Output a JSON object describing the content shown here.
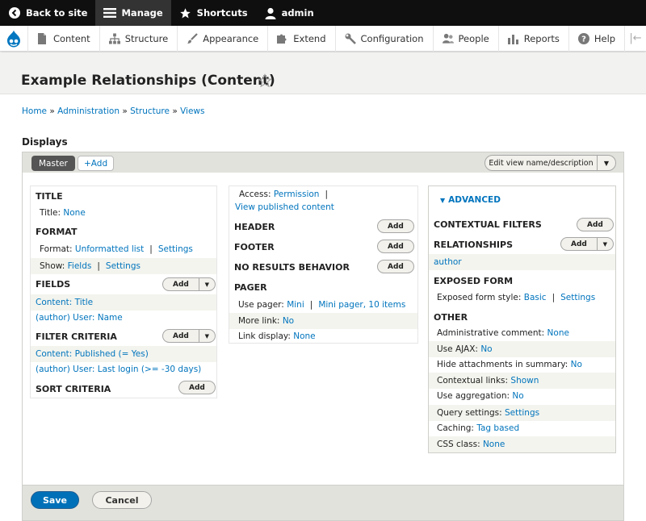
{
  "toolbar": {
    "back": "Back to site",
    "manage": "Manage",
    "shortcuts": "Shortcuts",
    "user": "admin"
  },
  "tray": {
    "items": [
      "Content",
      "Structure",
      "Appearance",
      "Extend",
      "Configuration",
      "People",
      "Reports",
      "Help"
    ]
  },
  "page": {
    "title": "Example Relationships (Content)",
    "breadcrumb": [
      "Home",
      "Administration",
      "Structure",
      "Views"
    ],
    "breadcrumb_sep": "»",
    "displays_label": "Displays"
  },
  "displays": {
    "master": "Master",
    "add": "+Add",
    "edit_view": "Edit view name/description"
  },
  "col1": {
    "title_section": "TITLE",
    "title_key": "Title:",
    "title_val": "None",
    "format_section": "FORMAT",
    "format_key": "Format:",
    "format_val": "Unformatted list",
    "format_settings": "Settings",
    "show_key": "Show:",
    "show_val": "Fields",
    "show_settings": "Settings",
    "fields_section": "FIELDS",
    "field1": "Content: Title",
    "field2": "(author) User: Name",
    "filter_section": "FILTER CRITERIA",
    "filter1": "Content: Published (= Yes)",
    "filter2": "(author) User: Last login (>= -30 days)",
    "sort_section": "SORT CRITERIA",
    "add": "Add"
  },
  "col2": {
    "access_key": "Access:",
    "access_val": "Permission",
    "access_val2": "View published content",
    "header_section": "HEADER",
    "footer_section": "FOOTER",
    "noresults_section": "NO RESULTS BEHAVIOR",
    "pager_section": "PAGER",
    "use_pager_key": "Use pager:",
    "use_pager_val": "Mini",
    "use_pager_val2": "Mini pager, 10 items",
    "more_link_key": "More link:",
    "more_link_val": "No",
    "link_display_key": "Link display:",
    "link_display_val": "None",
    "add": "Add",
    "pipe": "|"
  },
  "col3": {
    "advanced": "ADVANCED",
    "contextual_section": "CONTEXTUAL FILTERS",
    "relationships_section": "RELATIONSHIPS",
    "relationship1": "author",
    "exposed_section": "EXPOSED FORM",
    "exposed_key": "Exposed form style:",
    "exposed_val": "Basic",
    "exposed_settings": "Settings",
    "other_section": "OTHER",
    "other": [
      {
        "k": "Administrative comment:",
        "v": "None"
      },
      {
        "k": "Use AJAX:",
        "v": "No"
      },
      {
        "k": "Hide attachments in summary:",
        "v": "No"
      },
      {
        "k": "Contextual links:",
        "v": "Shown"
      },
      {
        "k": "Use aggregation:",
        "v": "No"
      },
      {
        "k": "Query settings:",
        "v": "Settings"
      },
      {
        "k": "Caching:",
        "v": "Tag based"
      },
      {
        "k": "CSS class:",
        "v": "None"
      }
    ],
    "add": "Add"
  },
  "actions": {
    "save": "Save",
    "cancel": "Cancel"
  },
  "colors": {
    "link": "#0074bd",
    "toolbar": "#0f0f0f",
    "primary": "#0071b8"
  }
}
